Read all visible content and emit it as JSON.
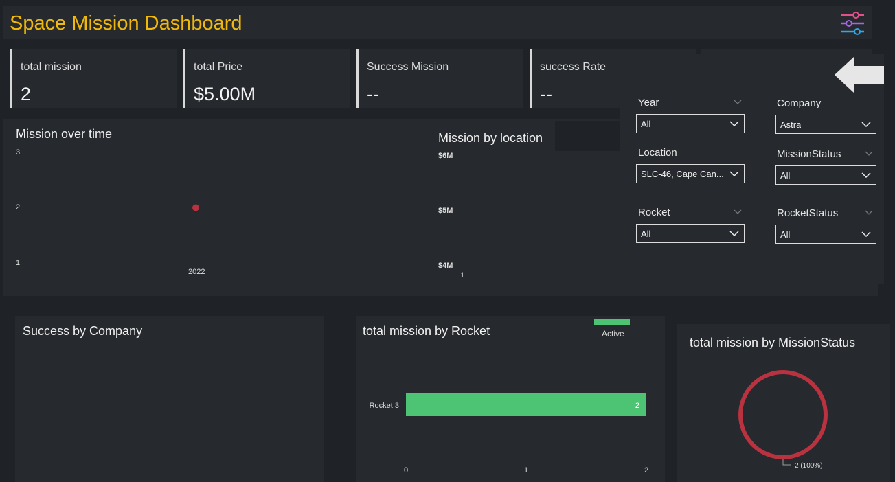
{
  "header": {
    "title": "Space Mission Dashboard"
  },
  "cards": [
    {
      "label": "total mission",
      "value": "2"
    },
    {
      "label": "total Price",
      "value": "$5.00M"
    },
    {
      "label": "Success Mission",
      "value": "--"
    },
    {
      "label": "success Rate",
      "value": "--"
    }
  ],
  "mission_over_time": {
    "title": "Mission over time",
    "y_ticks": [
      "3",
      "2",
      "1"
    ],
    "x_tick": "2022"
  },
  "mission_by_location": {
    "title": "Mission by location",
    "y_ticks": [
      "$6M",
      "$5M",
      "$4M"
    ],
    "x_tick": "1"
  },
  "slicers": {
    "year": {
      "label": "Year",
      "value": "All"
    },
    "company": {
      "label": "Company",
      "value": "Astra"
    },
    "location": {
      "label": "Location",
      "value": "SLC-46, Cape Can..."
    },
    "mission_status": {
      "label": "MissionStatus",
      "value": "All"
    },
    "rocket": {
      "label": "Rocket",
      "value": "All"
    },
    "rocket_status": {
      "label": "RocketStatus",
      "value": "All"
    }
  },
  "success_by_company": {
    "title": "Success by Company"
  },
  "by_rocket": {
    "title": "total mission by Rocket",
    "legend": "Active",
    "x_ticks": [
      "0",
      "1",
      "2"
    ]
  },
  "by_status": {
    "title": "total mission by MissionStatus"
  },
  "colors": {
    "accent": "#f0b80a",
    "bar": "#4cc474",
    "donut": "#b8323f",
    "point": "#b8323f"
  },
  "chart_data": [
    {
      "type": "scatter",
      "title": "Mission over time",
      "x": [
        "2022"
      ],
      "y": [
        2
      ],
      "ylim": [
        1,
        3
      ]
    },
    {
      "type": "bar",
      "title": "Mission by location",
      "categories": [
        "1"
      ],
      "values": [],
      "ylim": [
        4000000,
        6000000
      ]
    },
    {
      "type": "bar",
      "orientation": "horizontal",
      "title": "total mission by Rocket",
      "categories": [
        "Rocket 3"
      ],
      "series": [
        {
          "name": "Active",
          "values": [
            2
          ]
        }
      ],
      "data_labels": [
        "2"
      ],
      "xlim": [
        0,
        2
      ]
    },
    {
      "type": "pie",
      "title": "total mission by MissionStatus",
      "values": [
        2
      ],
      "labels": [
        "2 (100%)"
      ]
    }
  ]
}
